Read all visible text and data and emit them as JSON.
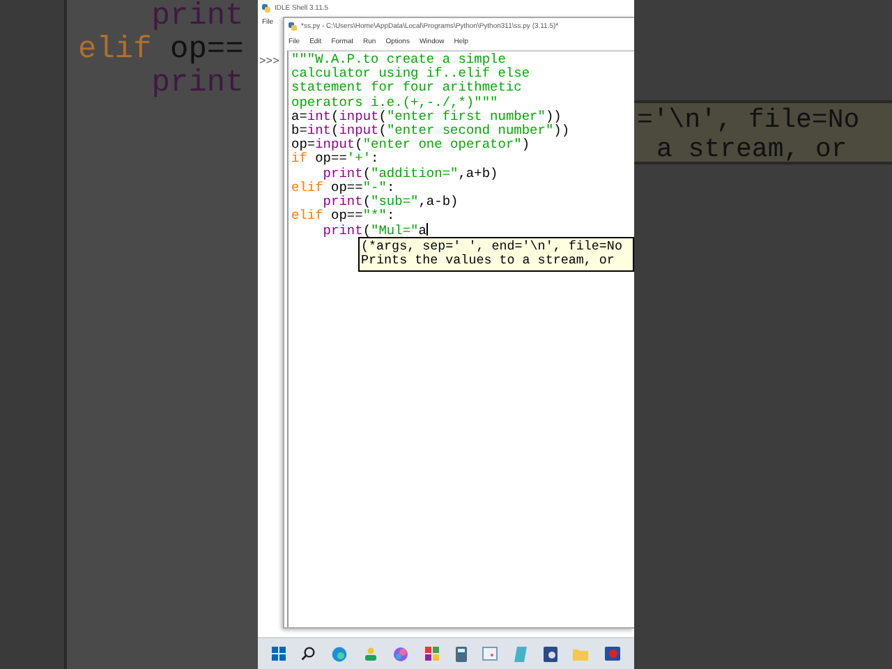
{
  "backdrop_left": {
    "lines": [
      {
        "indented": true,
        "segments": [
          {
            "kind": "builtin",
            "text": "print"
          }
        ]
      },
      {
        "indented": false,
        "segments": [
          {
            "kind": "keyword",
            "text": "elif"
          },
          {
            "kind": "plain",
            "text": " op=="
          }
        ]
      },
      {
        "indented": true,
        "segments": [
          {
            "kind": "builtin",
            "text": "print"
          }
        ]
      }
    ]
  },
  "shell": {
    "title": "IDLE Shell 3.11.5",
    "menu": [
      "File"
    ],
    "prompt": ">>>"
  },
  "editor": {
    "title": "*ss.py - C:\\Users\\Home\\AppData\\Local\\Programs\\Python\\Python311\\ss.py (3.11.5)*",
    "menu": [
      "File",
      "Edit",
      "Format",
      "Run",
      "Options",
      "Window",
      "Help"
    ],
    "lines": [
      {
        "indented": false,
        "segments": [
          {
            "kind": "string",
            "text": "\"\"\"W.A.P.to create a simple"
          }
        ]
      },
      {
        "indented": false,
        "segments": [
          {
            "kind": "string",
            "text": "calculator using if..elif else"
          }
        ]
      },
      {
        "indented": false,
        "segments": [
          {
            "kind": "string",
            "text": "statement for four arithmetic"
          }
        ]
      },
      {
        "indented": false,
        "segments": [
          {
            "kind": "string",
            "text": "operators i.e.(+,-./,*)\"\"\""
          }
        ]
      },
      {
        "indented": false,
        "segments": [
          {
            "kind": "plain",
            "text": "a="
          },
          {
            "kind": "builtin",
            "text": "int"
          },
          {
            "kind": "plain",
            "text": "("
          },
          {
            "kind": "builtin",
            "text": "input"
          },
          {
            "kind": "plain",
            "text": "("
          },
          {
            "kind": "string",
            "text": "\"enter first number\""
          },
          {
            "kind": "plain",
            "text": "))"
          }
        ]
      },
      {
        "indented": false,
        "segments": [
          {
            "kind": "plain",
            "text": "b="
          },
          {
            "kind": "builtin",
            "text": "int"
          },
          {
            "kind": "plain",
            "text": "("
          },
          {
            "kind": "builtin",
            "text": "input"
          },
          {
            "kind": "plain",
            "text": "("
          },
          {
            "kind": "string",
            "text": "\"enter second number\""
          },
          {
            "kind": "plain",
            "text": "))"
          }
        ]
      },
      {
        "indented": false,
        "segments": [
          {
            "kind": "plain",
            "text": "op="
          },
          {
            "kind": "builtin",
            "text": "input"
          },
          {
            "kind": "plain",
            "text": "("
          },
          {
            "kind": "string",
            "text": "\"enter one operator\""
          },
          {
            "kind": "plain",
            "text": ")"
          }
        ]
      },
      {
        "indented": false,
        "segments": [
          {
            "kind": "keyword",
            "text": "if"
          },
          {
            "kind": "plain",
            "text": " op=="
          },
          {
            "kind": "string",
            "text": "'+'"
          },
          {
            "kind": "plain",
            "text": ":"
          }
        ]
      },
      {
        "indented": true,
        "segments": [
          {
            "kind": "builtin",
            "text": "print"
          },
          {
            "kind": "plain",
            "text": "("
          },
          {
            "kind": "string",
            "text": "\"addition=\""
          },
          {
            "kind": "plain",
            "text": ",a+b)"
          }
        ]
      },
      {
        "indented": false,
        "segments": [
          {
            "kind": "keyword",
            "text": "elif"
          },
          {
            "kind": "plain",
            "text": " op=="
          },
          {
            "kind": "string",
            "text": "\"-\""
          },
          {
            "kind": "plain",
            "text": ":"
          }
        ]
      },
      {
        "indented": true,
        "segments": [
          {
            "kind": "builtin",
            "text": "print"
          },
          {
            "kind": "plain",
            "text": "("
          },
          {
            "kind": "string",
            "text": "\"sub=\""
          },
          {
            "kind": "plain",
            "text": ",a-b)"
          }
        ]
      },
      {
        "indented": false,
        "segments": [
          {
            "kind": "keyword",
            "text": "elif"
          },
          {
            "kind": "plain",
            "text": " op=="
          },
          {
            "kind": "string",
            "text": "\"*\""
          },
          {
            "kind": "plain",
            "text": ":"
          }
        ]
      },
      {
        "indented": true,
        "segments": [
          {
            "kind": "builtin",
            "text": "print"
          },
          {
            "kind": "plain",
            "text": "("
          },
          {
            "kind": "string",
            "text": "\"Mul=\""
          },
          {
            "kind": "plain",
            "text": "a"
          }
        ]
      }
    ],
    "calltip": [
      "(*args, sep=' ', end='\\n', file=No",
      "Prints the values to a stream, or"
    ]
  },
  "backdrop_right": {
    "calltip": [
      "='\\n', file=No",
      "a stream, or"
    ]
  }
}
